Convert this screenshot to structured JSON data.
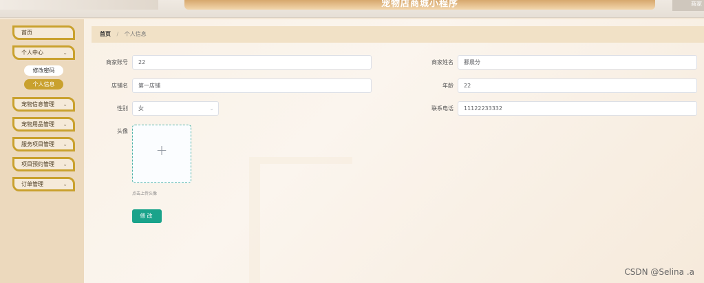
{
  "header": {
    "app_title": "宠物店商城小程序",
    "corner_text": "商家"
  },
  "sidebar": {
    "items": [
      {
        "label": "首页"
      },
      {
        "label": "个人中心",
        "chevron": "⌄"
      },
      {
        "label": "宠物信息管理",
        "chevron": "⌄"
      },
      {
        "label": "宠物用品管理",
        "chevron": "⌄"
      },
      {
        "label": "服务项目管理",
        "chevron": "⌄"
      },
      {
        "label": "项目预约管理",
        "chevron": "⌄"
      },
      {
        "label": "订单管理",
        "chevron": "⌄"
      }
    ],
    "subitems": [
      {
        "label": "修改密码"
      },
      {
        "label": "个人信息"
      }
    ]
  },
  "breadcrumb": {
    "home": "首页",
    "separator": "/",
    "current": "个人信息"
  },
  "form": {
    "account_label": "商家账号",
    "account_value": "22",
    "name_label": "商家姓名",
    "name_value": "鄱晨分",
    "shop_label": "店铺名",
    "shop_value": "第一店铺",
    "age_label": "年龄",
    "age_value": "22",
    "gender_label": "性别",
    "gender_value": "女",
    "gender_chevron": "⌄",
    "phone_label": "联系电话",
    "phone_value": "11122233332",
    "avatar_label": "头像",
    "upload_plus": "+",
    "upload_hint": "点击上传头像",
    "submit_label": "修改"
  },
  "watermark": "CSDN @Selina .a"
}
